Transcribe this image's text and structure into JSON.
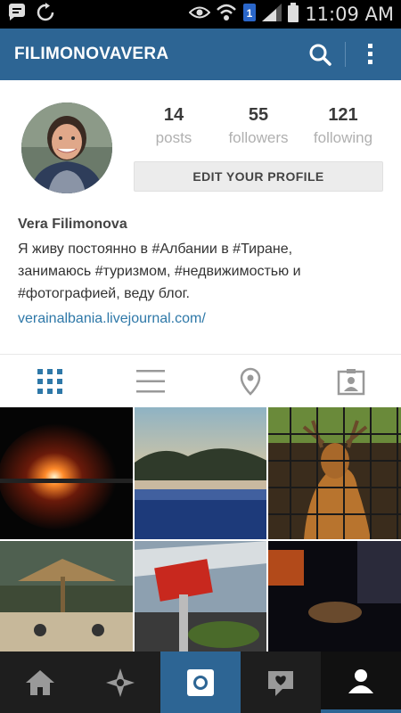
{
  "status_bar": {
    "time": "11:09 AM"
  },
  "app_bar": {
    "title": "FILIMONOVAVERA"
  },
  "profile": {
    "posts_count": "14",
    "posts_label": "posts",
    "followers_count": "55",
    "followers_label": "followers",
    "following_count": "121",
    "following_label": "following",
    "edit_button": "EDIT YOUR PROFILE"
  },
  "bio": {
    "name": "Vera Filimonova",
    "line1": "Я живу постоянно в #Албании в #Тиране,",
    "line2": "занимаюсь #туризмом, #недвижимостью и",
    "line3": "#фотографией, веду блог.",
    "link": "verainalbania.livejournal.com/"
  },
  "tabs": [
    "grid-icon",
    "list-icon",
    "location-pin-icon",
    "tagged-photos-icon"
  ],
  "navbar": [
    "home-icon",
    "explore-icon",
    "camera-icon",
    "activity-icon",
    "profile-icon"
  ],
  "colors": {
    "brand": "#2d6594",
    "link": "#2e78a8",
    "navbar": "#1e1e1e"
  }
}
